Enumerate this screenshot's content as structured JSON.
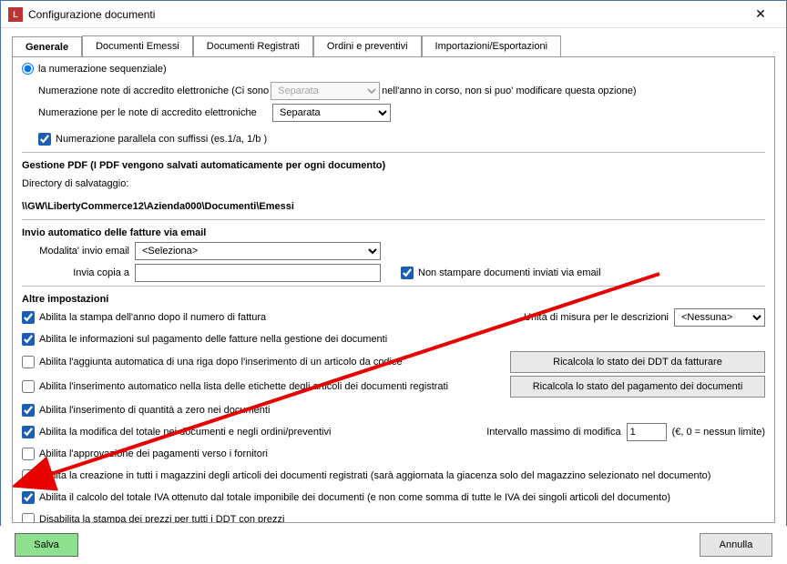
{
  "window": {
    "title": "Configurazione documenti",
    "icon_label": "L"
  },
  "tabs": {
    "generale": "Generale",
    "emessi": "Documenti Emessi",
    "registrati": "Documenti Registrati",
    "ordini": "Ordini e preventivi",
    "impexp": "Importazioni/Esportazioni"
  },
  "top_fragment": {
    "radio_truncated_tail": "la numerazione sequenziale)",
    "num_note_label_pre": "Numerazione note di accredito elettroniche (Ci sono",
    "num_note_value": "Separata",
    "num_note_label_post": "nell'anno in corso, non si puo' modificare questa opzione)",
    "num_per_note_label": "Numerazione per le note di accredito elettroniche",
    "num_per_note_value": "Separata",
    "parallela_label": "Numerazione parallela con suffissi (es.1/a, 1/b )"
  },
  "pdf": {
    "head": "Gestione PDF (I PDF vengono salvati automaticamente per ogni documento)",
    "dir_label": "Directory di salvataggio:",
    "dir_value": "\\\\GW\\LibertyCommerce12\\Azienda000\\Documenti\\Emessi"
  },
  "email": {
    "head": "Invio automatico delle fatture via email",
    "modalita_label": "Modalita' invio email",
    "modalita_value": "<Seleziona>",
    "copia_label": "Invia copia a",
    "copia_value": "",
    "nostampa_label": "Non stampare documenti inviati via email"
  },
  "altre": {
    "head": "Altre impostazioni",
    "c1": "Abilita la stampa dell'anno dopo il numero di fattura",
    "c2": "Abilita le informazioni sul pagamento delle fatture nella gestione dei documenti",
    "c3": "Abilita l'aggiunta automatica di una riga dopo l'inserimento di un articolo da codice",
    "c4": "Abilita l'inserimento automatico nella lista delle etichette degli articoli dei documenti registrati",
    "c5": "Abilita l'inserimento di quantità a zero nei documenti",
    "c6": "Abilita la modifica del totale nei documenti e negli ordini/preventivi",
    "c7": "Abilita l'approvazione dei pagamenti verso i fornitori",
    "c8": "Abilita la creazione in tutti i magazzini degli articoli dei documenti registrati (sarà aggiornata la giacenza solo del magazzino selezionato nel documento)",
    "c9": "Abilita il calcolo del totale IVA ottenuto dal totale imponibile dei documenti (e non come somma di tutte le IVA dei singoli articoli del documento)",
    "c10": "Disabilita la stampa dei prezzi per tutti i DDT con prezzi",
    "unita_label": "Unità di misura per le descrizioni",
    "unita_value": "<Nessuna>",
    "btn_ddt": "Ricalcola lo stato dei DDT da fatturare",
    "btn_pag": "Ricalcola lo stato del pagamento dei documenti",
    "intervallo_label": "Intervallo massimo di modifica",
    "intervallo_value": "1",
    "intervallo_hint": "(€, 0 = nessun limite)"
  },
  "footer": {
    "save": "Salva",
    "cancel": "Annulla"
  },
  "checks": {
    "parallela": true,
    "nostampa": true,
    "c1": true,
    "c2": true,
    "c3": false,
    "c4": false,
    "c5": true,
    "c6": true,
    "c7": false,
    "c8": false,
    "c9": true,
    "c10": false
  }
}
